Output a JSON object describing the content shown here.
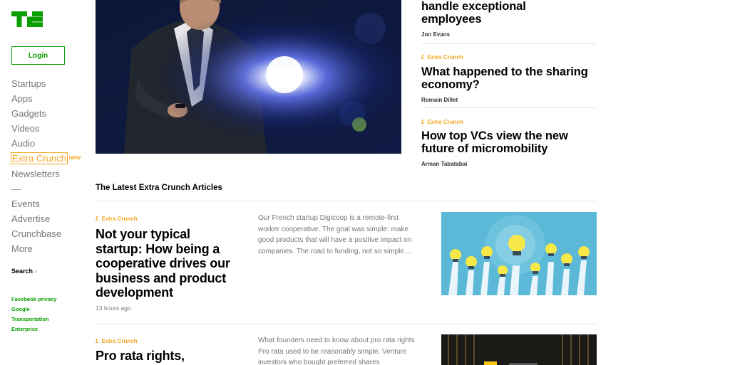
{
  "sidebar": {
    "logo_icon": "techcrunch-logo-icon",
    "login_label": "Login",
    "nav": [
      {
        "label": "Startups"
      },
      {
        "label": "Apps"
      },
      {
        "label": "Gadgets"
      },
      {
        "label": "Videos"
      },
      {
        "label": "Audio"
      },
      {
        "label": "Extra Crunch",
        "badge": "NEW",
        "active": true
      },
      {
        "label": "Newsletters"
      },
      {
        "label": "Events"
      },
      {
        "label": "Advertise"
      },
      {
        "label": "Crunchbase"
      },
      {
        "label": "More"
      }
    ],
    "search_label": "Search",
    "search_icon": "search-icon",
    "trending": [
      "Facebook privacy",
      "Google",
      "Transportation",
      "Enterprise"
    ]
  },
  "top_stories": [
    {
      "headline": "handle exceptional employees",
      "author": "Jon Evans"
    },
    {
      "tag": "Extra Crunch",
      "headline": "What happened to the sharing economy?",
      "author": "Romain Dillet"
    },
    {
      "tag": "Extra Crunch",
      "headline": "How top VCs view the new future of micromobility",
      "author": "Arman Tabatabai"
    }
  ],
  "latest": {
    "title": "The Latest Extra Crunch Articles",
    "articles": [
      {
        "tag": "Extra Crunch",
        "headline": "Not your typical startup: How being a cooperative drives our business and product development",
        "time": "13 hours ago",
        "excerpt": "Our French startup Digicoop is a remote-first worker cooperative. The goal was simple: make good products that will have a positive impact on companies. The road to funding, not so simple…"
      },
      {
        "tag": "Extra Crunch",
        "headline": "Pro rata rights,",
        "excerpt": "What founders need to know about pro rata rights Pro rata used to be reasonably simple. Venture investors who bought preferred shares"
      }
    ]
  },
  "colors": {
    "brand_green": "#0a9e01",
    "extra_crunch_gold": "#f5a623"
  }
}
